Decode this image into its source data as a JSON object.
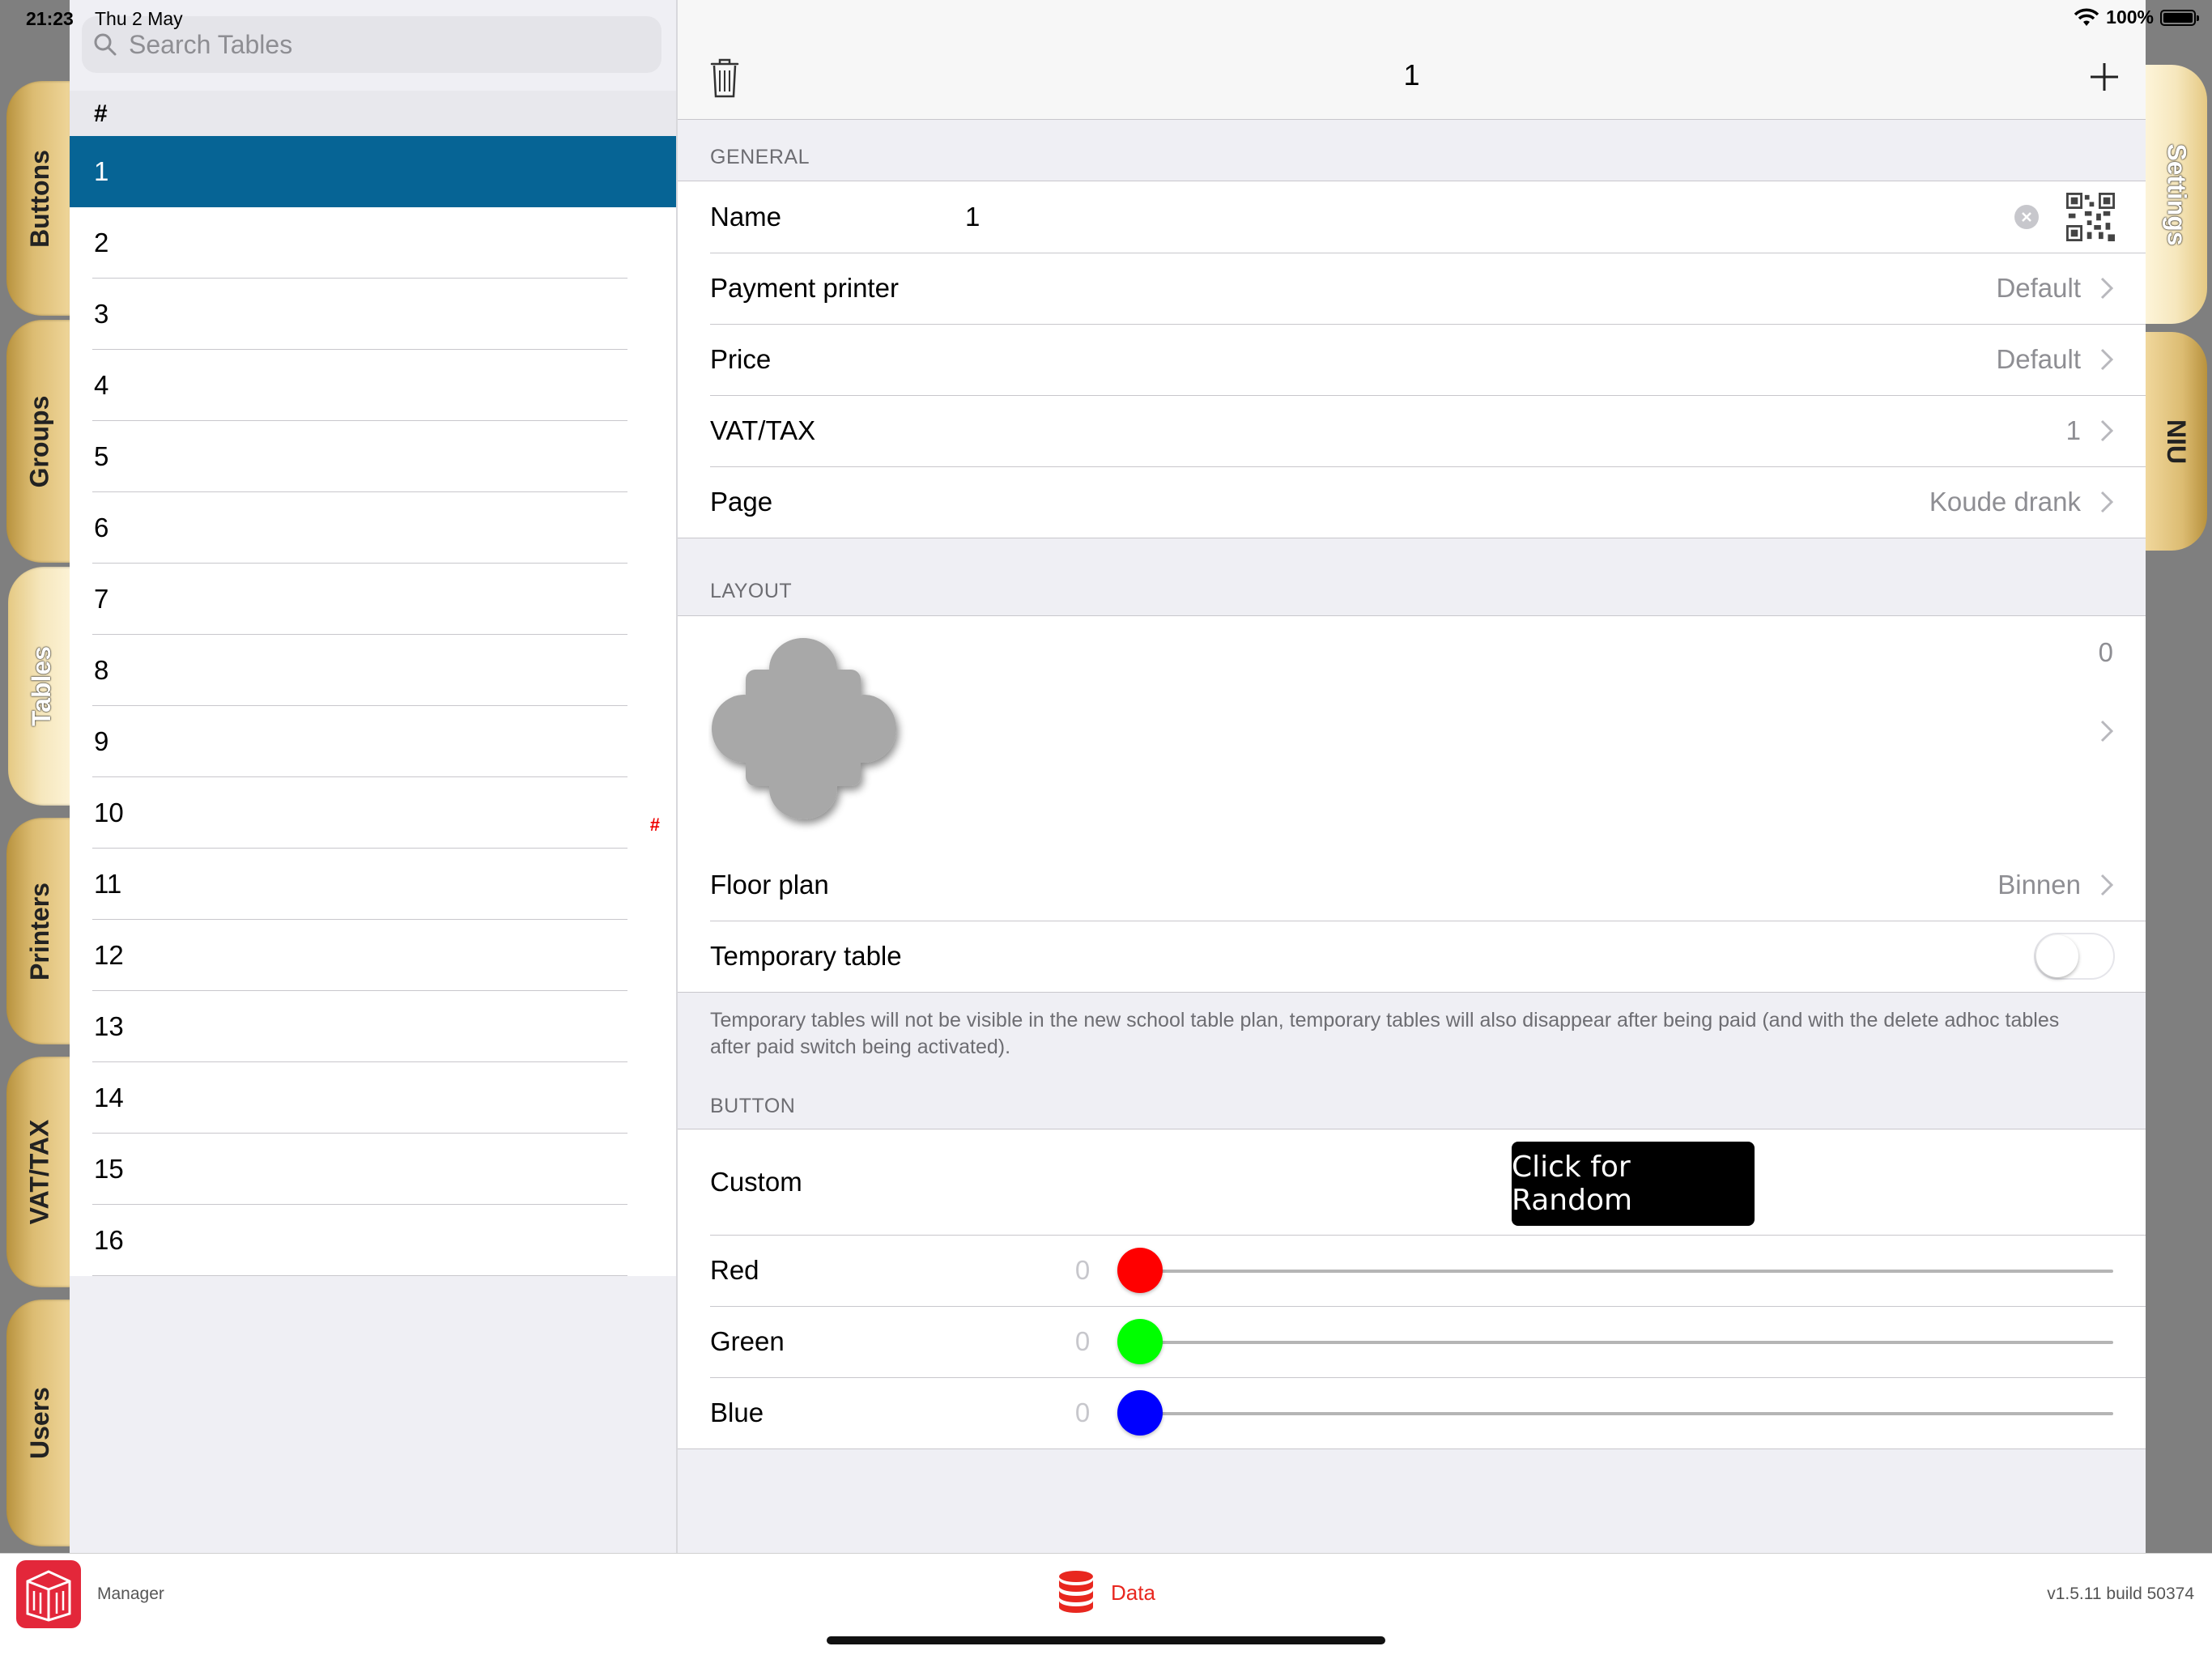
{
  "status_bar": {
    "time": "21:23",
    "date": "Thu 2 May",
    "battery": "100%"
  },
  "left_tabs": [
    "Buttons",
    "Groups",
    "Tables",
    "Printers",
    "VAT/TAX",
    "Users"
  ],
  "right_tabs": [
    "Settings",
    "NIU"
  ],
  "active_left_tab": "Tables",
  "active_right_tab": "Settings",
  "search": {
    "placeholder": "Search Tables"
  },
  "list": {
    "section_header": "#",
    "items": [
      "1",
      "2",
      "3",
      "4",
      "5",
      "6",
      "7",
      "8",
      "9",
      "10",
      "11",
      "12",
      "13",
      "14",
      "15",
      "16"
    ],
    "selected": "1",
    "marked_item": "10",
    "mark_symbol": "#"
  },
  "detail": {
    "title": "1",
    "general": {
      "header": "GENERAL",
      "name_label": "Name",
      "name_value": "1",
      "payment_printer_label": "Payment printer",
      "payment_printer_value": "Default",
      "price_label": "Price",
      "price_value": "Default",
      "vat_label": "VAT/TAX",
      "vat_value": "1",
      "page_label": "Page",
      "page_value": "Koude drank"
    },
    "layout": {
      "header": "LAYOUT",
      "count": "0",
      "floor_plan_label": "Floor plan",
      "floor_plan_value": "Binnen",
      "temporary_label": "Temporary table",
      "temporary_on": false,
      "footnote": "Temporary tables will not be visible in the new school table plan, temporary tables will also disappear after being paid (and with the delete adhoc tables after paid switch being activated)."
    },
    "button": {
      "header": "BUTTON",
      "custom_label": "Custom",
      "random_button": "Click for Random",
      "red_label": "Red",
      "red_value": "0",
      "green_label": "Green",
      "green_value": "0",
      "blue_label": "Blue",
      "blue_value": "0"
    }
  },
  "bottom_bar": {
    "app_name": "Manager",
    "data_tab": "Data",
    "version": "v1.5.11 build 50374"
  },
  "colors": {
    "selection": "#066495",
    "accent_red": "#e8271f",
    "slider_red": "#ff0000",
    "slider_green": "#00ff00",
    "slider_blue": "#0000ff",
    "tab_gold": "#e9cf8f"
  }
}
